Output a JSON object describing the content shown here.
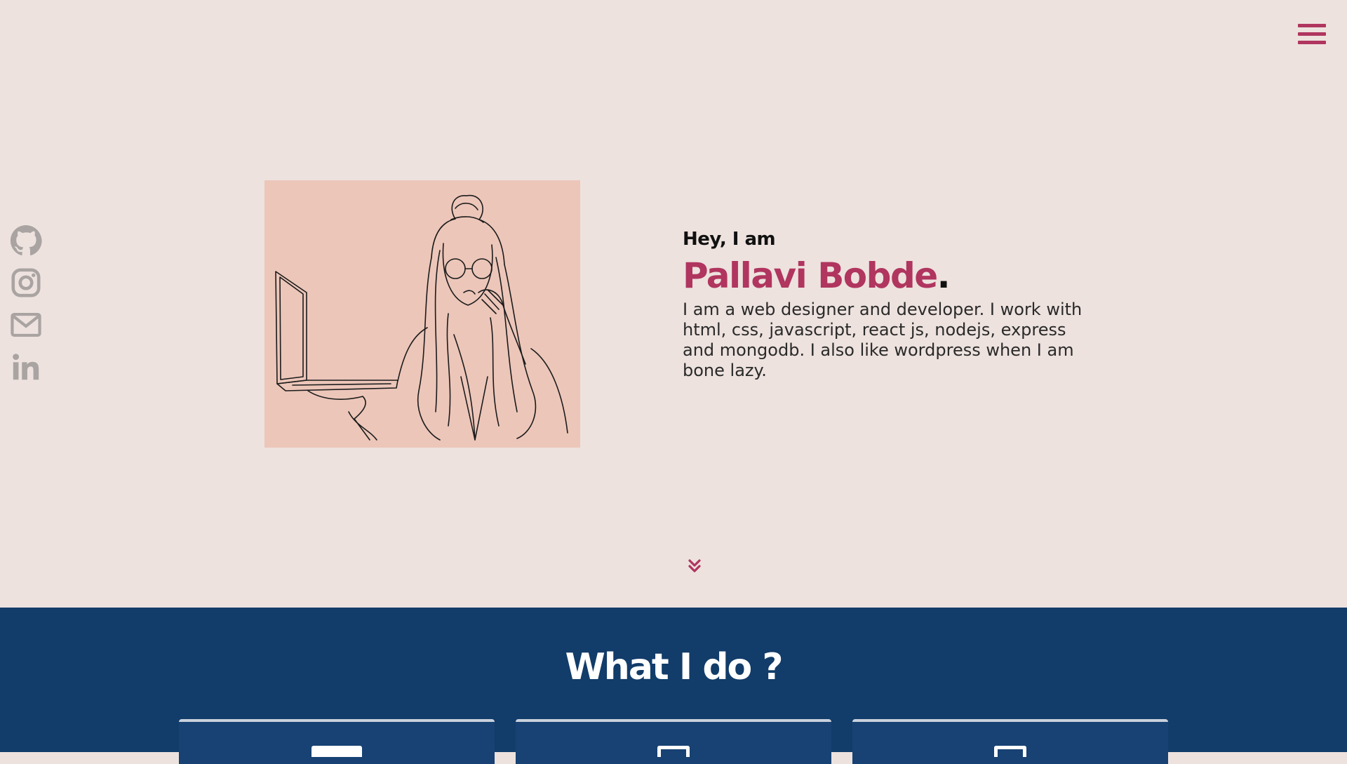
{
  "nav": {
    "menu_icon": "hamburger-icon"
  },
  "social": [
    {
      "name": "GitHub",
      "icon": "github-icon"
    },
    {
      "name": "Instagram",
      "icon": "instagram-icon"
    },
    {
      "name": "Email",
      "icon": "mail-icon"
    },
    {
      "name": "LinkedIn",
      "icon": "linkedin-icon"
    }
  ],
  "hero": {
    "greeting": "Hey, I am",
    "name": "Pallavi Bobde",
    "name_suffix": ".",
    "bio": "I am a web designer and developer. I work with html, css, javascript, react js, nodejs, express and mongodb. I also like wordpress when I am bone lazy.",
    "scroll_icon": "double-chevron-down-icon"
  },
  "services": {
    "title": "What I do ?"
  },
  "colors": {
    "background": "#ede2de",
    "accent": "#b0355f",
    "navy": "#123c69",
    "image_bg": "#ecc6b9",
    "icon_gray": "#a9a4a2"
  }
}
